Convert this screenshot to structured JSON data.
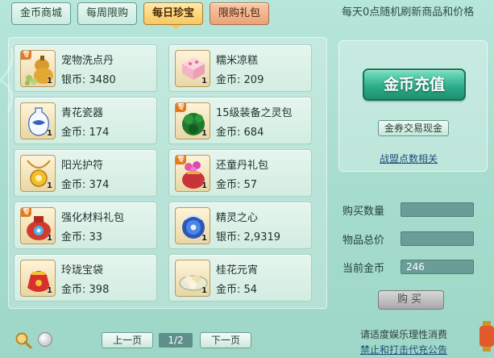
{
  "tabs": [
    {
      "label": "金币商城",
      "state": "normal"
    },
    {
      "label": "每周限购",
      "state": "normal"
    },
    {
      "label": "每日珍宝",
      "state": "active"
    },
    {
      "label": "限购礼包",
      "state": "promo"
    }
  ],
  "refresh_note": "每天0点随机刷新商品和价格",
  "items": [
    {
      "name": "宠物洗点丹",
      "currency": "银币",
      "price": "3480",
      "qty": "1",
      "tag": "专",
      "icon": "gourd-pills-icon"
    },
    {
      "name": "糯米凉糕",
      "currency": "金币",
      "price": "209",
      "qty": "1",
      "tag": "",
      "icon": "rice-cake-icon"
    },
    {
      "name": "青花瓷器",
      "currency": "金币",
      "price": "174",
      "qty": "1",
      "tag": "",
      "icon": "porcelain-vase-icon"
    },
    {
      "name": "15级装备之灵包",
      "currency": "金币",
      "price": "684",
      "qty": "1",
      "tag": "专",
      "icon": "green-spirit-bag-icon"
    },
    {
      "name": "阳光护符",
      "currency": "金币",
      "price": "374",
      "qty": "1",
      "tag": "",
      "icon": "sun-amulet-icon"
    },
    {
      "name": "还童丹礼包",
      "currency": "金币",
      "price": "57",
      "qty": "1",
      "tag": "专",
      "icon": "gift-sack-icon"
    },
    {
      "name": "强化材料礼包",
      "currency": "金币",
      "price": "33",
      "qty": "1",
      "tag": "专",
      "icon": "material-sack-icon"
    },
    {
      "name": "精灵之心",
      "currency": "银币",
      "price": "2,9319",
      "qty": "1",
      "tag": "",
      "icon": "spirit-heart-icon"
    },
    {
      "name": "玲珑宝袋",
      "currency": "金币",
      "price": "398",
      "qty": "1",
      "tag": "",
      "icon": "treasure-pouch-icon"
    },
    {
      "name": "桂花元宵",
      "currency": "金币",
      "price": "54",
      "qty": "1",
      "tag": "",
      "icon": "rice-dumplings-icon"
    }
  ],
  "side": {
    "recharge_label": "金币充值",
    "exchange_label": "金券交易现金",
    "guild_link": "战盟点数相关"
  },
  "form": {
    "qty_label": "购买数量",
    "qty_value": "",
    "total_label": "物品总价",
    "total_value": "",
    "gold_label": "当前金币",
    "gold_value": "246",
    "buy_label": "购买"
  },
  "pager": {
    "prev": "上一页",
    "page": "1/2",
    "next": "下一页"
  },
  "notices": {
    "line1": "请适度娱乐理性消费",
    "line2": "禁止和打击代充公告"
  },
  "colors": {
    "background": "#a9ddd0",
    "active_tab": "#f7c860",
    "promo_tab": "#e9a27b",
    "recharge": "#2fae8b",
    "field": "#6a9c98"
  }
}
